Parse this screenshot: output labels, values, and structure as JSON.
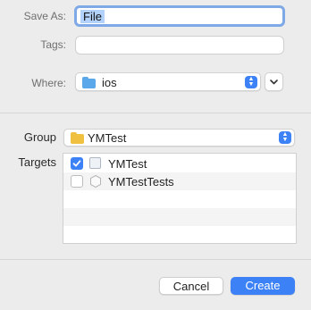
{
  "save_as": {
    "label": "Save As:",
    "value": "File"
  },
  "tags": {
    "label": "Tags:",
    "value": ""
  },
  "where": {
    "label": "Where:",
    "folder_name": "ios"
  },
  "group": {
    "label": "Group",
    "folder_name": "YMTest"
  },
  "targets": {
    "label": "Targets",
    "items": [
      {
        "name": "YMTest",
        "checked": true
      },
      {
        "name": "YMTestTests",
        "checked": false
      }
    ]
  },
  "buttons": {
    "cancel": "Cancel",
    "create": "Create"
  },
  "colors": {
    "accent": "#3c82f6",
    "where_folder": "#5aa7ea",
    "group_folder": "#f0c040"
  }
}
